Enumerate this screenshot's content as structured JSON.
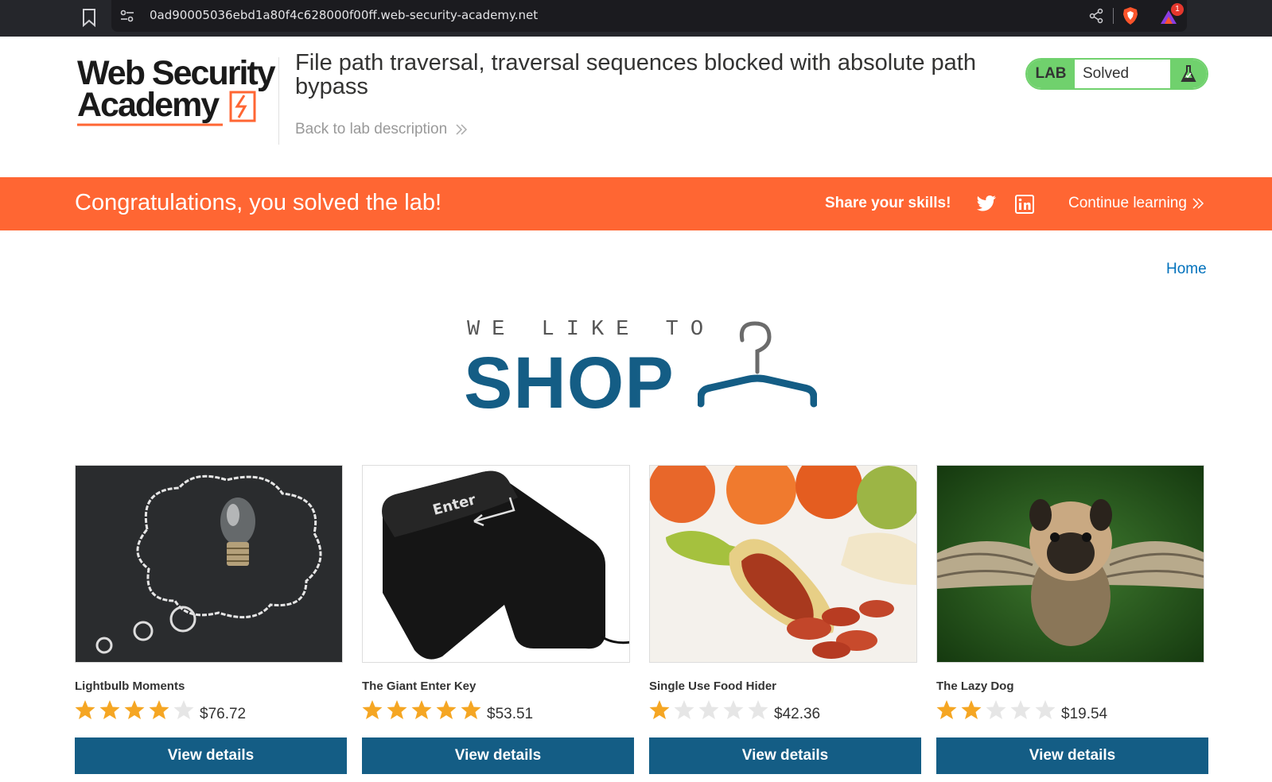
{
  "browser": {
    "url": "0ad90005036ebd1a80f4c628000f00ff.web-security-academy.net",
    "rewards_count": "1",
    "icons": [
      "bookmark-icon",
      "site-info-icon",
      "share-icon",
      "brave-shield-icon",
      "brave-rewards-icon"
    ]
  },
  "header": {
    "logo_line1": "Web Security",
    "logo_line2": "Academy",
    "lab_title": "File path traversal, traversal sequences blocked with absolute path bypass",
    "back_link": "Back to lab description",
    "lab_badge": "LAB",
    "lab_status": "Solved"
  },
  "banner": {
    "message": "Congratulations, you solved the lab!",
    "share_label": "Share your skills!",
    "continue_label": "Continue learning"
  },
  "nav": {
    "home": "Home"
  },
  "shop_logo": {
    "tagline": "WE LIKE TO",
    "word": "SHOP"
  },
  "products": [
    {
      "name": "Lightbulb Moments",
      "rating": 4,
      "price": "$76.72",
      "button": "View details",
      "image": "lightbulb-thought-cloud"
    },
    {
      "name": "The Giant Enter Key",
      "rating": 5,
      "price": "$53.51",
      "button": "View details",
      "image": "giant-enter-key"
    },
    {
      "name": "Single Use Food Hider",
      "rating": 1,
      "price": "$42.36",
      "button": "View details",
      "image": "sausage-in-banana"
    },
    {
      "name": "The Lazy Dog",
      "rating": 2,
      "price": "$19.54",
      "button": "View details",
      "image": "pug-with-wings"
    }
  ],
  "colors": {
    "brand_orange": "#ff6633",
    "brand_blue": "#145d85",
    "solved_green": "#70d16d",
    "link_blue": "#0071bc",
    "star_gold": "#f5a623"
  }
}
